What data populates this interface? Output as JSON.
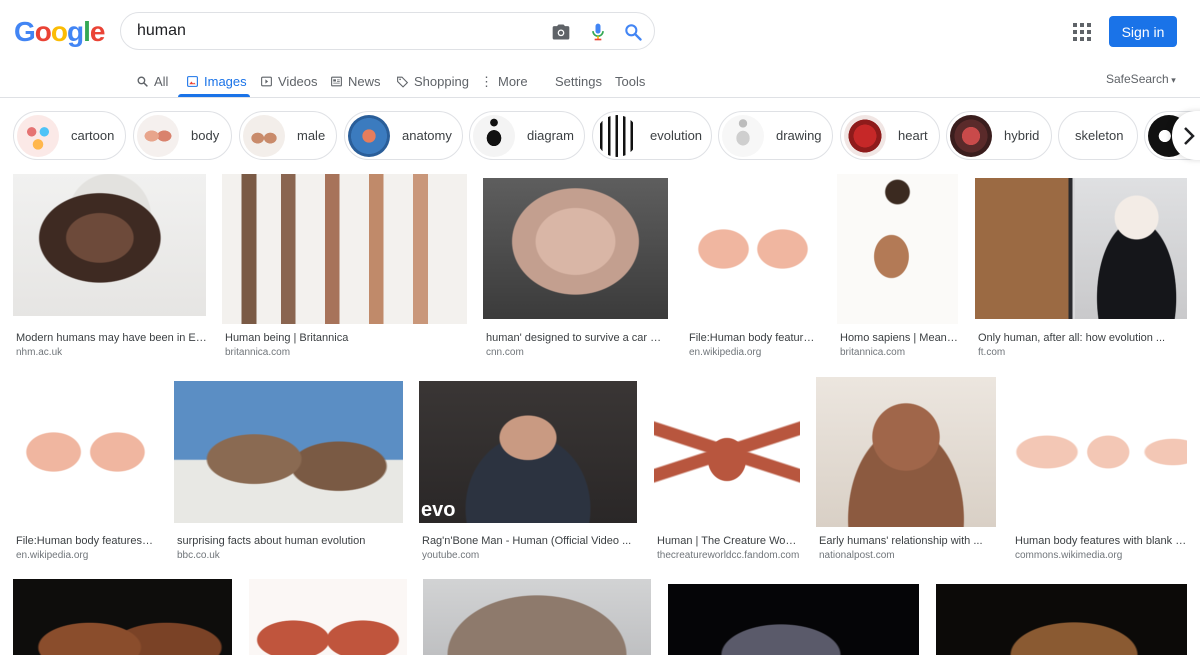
{
  "search": {
    "query": "human"
  },
  "header": {
    "signin_label": "Sign in"
  },
  "tabs": [
    {
      "label": "All"
    },
    {
      "label": "Images"
    },
    {
      "label": "Videos"
    },
    {
      "label": "News"
    },
    {
      "label": "Shopping"
    },
    {
      "label": "More"
    },
    {
      "label": "Settings"
    },
    {
      "label": "Tools"
    }
  ],
  "safesearch_label": "SafeSearch",
  "chips": [
    {
      "label": "cartoon"
    },
    {
      "label": "body"
    },
    {
      "label": "male"
    },
    {
      "label": "anatomy"
    },
    {
      "label": "diagram"
    },
    {
      "label": "evolution"
    },
    {
      "label": "drawing"
    },
    {
      "label": "heart"
    },
    {
      "label": "hybrid"
    },
    {
      "label": "skeleton"
    }
  ],
  "results": [
    {
      "title": "Modern humans may have been in Eur...",
      "source": "nhm.ac.uk"
    },
    {
      "title": "Human being | Britannica",
      "source": "britannica.com"
    },
    {
      "title": "human' designed to survive a car cra...",
      "source": "cnn.com"
    },
    {
      "title": "File:Human body features...",
      "source": "en.wikipedia.org"
    },
    {
      "title": "Homo sapiens | Meani...",
      "source": "britannica.com"
    },
    {
      "title": "Only human, after all: how evolution ...",
      "source": "ft.com"
    },
    {
      "title": "File:Human body features-c...",
      "source": "en.wikipedia.org"
    },
    {
      "title": "surprising facts about human evolution",
      "source": "bbc.co.uk"
    },
    {
      "title": "Rag'n'Bone Man - Human (Official Video ...",
      "source": "youtube.com"
    },
    {
      "title": "Human | The Creature World...",
      "source": "thecreatureworldcc.fandom.com"
    },
    {
      "title": "Early humans' relationship with ...",
      "source": "nationalpost.com"
    },
    {
      "title": "Human body features with blank la...",
      "source": "commons.wikimedia.org"
    }
  ],
  "overlay": {
    "evo": "evo"
  },
  "colors": {
    "accent": "#1a73e8",
    "signin_bg": "#1a73e8",
    "text_secondary": "#70757a"
  }
}
